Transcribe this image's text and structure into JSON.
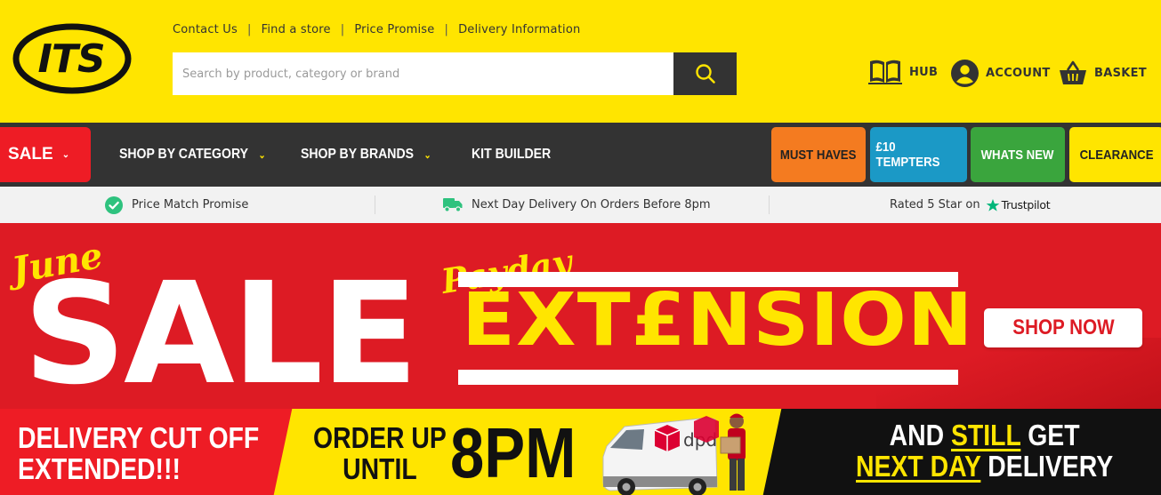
{
  "header": {
    "logo_text": "ITS",
    "top_links": [
      "Contact Us",
      "Find a store",
      "Price Promise",
      "Delivery Information"
    ],
    "separator": "|",
    "search": {
      "placeholder": "Search by product, category or brand",
      "value": ""
    },
    "actions": {
      "hub": "HUB",
      "account": "ACCOUNT",
      "basket": "BASKET"
    }
  },
  "nav": {
    "sale": "SALE",
    "shop_by_category": "SHOP BY CATEGORY",
    "shop_by_brands": "SHOP BY BRANDS",
    "kit_builder": "KIT BUILDER",
    "pills": [
      {
        "label": "MUST HAVES",
        "bg": "#f47b20",
        "fg": "#222222"
      },
      {
        "label": "£10 TEMPTERS",
        "bg": "#1b99c6",
        "fg": "#ffffff"
      },
      {
        "label": "WHATS NEW",
        "bg": "#3aa53d",
        "fg": "#ffffff"
      },
      {
        "label": "CLEARANCE",
        "bg": "#ffe500",
        "fg": "#222222"
      }
    ]
  },
  "usp": {
    "price_match": "Price Match Promise",
    "next_day": "Next Day Delivery On Orders Before 8pm",
    "rated": "Rated 5 Star on",
    "trustpilot": "Trustpilot"
  },
  "banner": {
    "june": "June",
    "sale": "SALE",
    "payday": "Payday",
    "extension": "EXT£NSION",
    "cta": "SHOP NOW"
  },
  "delivery_banner": {
    "left_line1": "DELIVERY CUT OFF",
    "left_line2": "EXTENDED!!!",
    "order_line1": "ORDER UP",
    "order_line2": "UNTIL",
    "time": "8PM",
    "van_brand": "dpd",
    "right_line1_a": "AND ",
    "right_line1_b": "STILL",
    "right_line1_c": " GET",
    "right_line2_a": "NEXT DAY",
    "right_line2_b": " DELIVERY"
  },
  "colors": {
    "brand_yellow": "#ffe500",
    "nav_dark": "#333333",
    "sale_red": "#ee1c25",
    "usp_check": "#2ec27e"
  }
}
